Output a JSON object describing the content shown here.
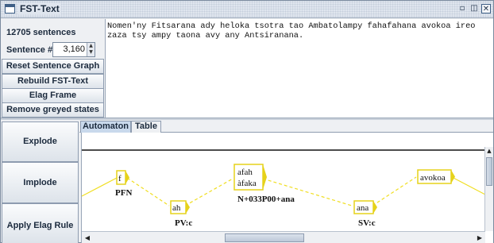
{
  "window": {
    "title": "FST-Text",
    "minimize_glyph": "▫",
    "maximize_glyph": "◫",
    "close_glyph": "✕"
  },
  "sidebar": {
    "sentence_count": "12705 sentences",
    "sentence_label": "Sentence #",
    "sentence_value": "3,160",
    "buttons": {
      "reset": "Reset Sentence Graph",
      "rebuild": "Rebuild FST-Text",
      "elag_frame": "Elag Frame",
      "remove_greyed": "Remove greyed states",
      "explode": "Explode",
      "implode": "Implode",
      "apply_elag": "Apply Elag Rule"
    }
  },
  "text": {
    "content": "Nomen'ny Fitsarana ady heloka tsotra tao Ambatolampy fahafahana avokoa ireo zaza tsy ampy taona avy any Antsiranana."
  },
  "tabs": [
    "Automaton",
    "Table"
  ],
  "active_tab": "Automaton",
  "graph": {
    "colors": {
      "box_border": "#e6d21a",
      "box_fill": "#ffffff",
      "edge": "#f0de20"
    },
    "boxes": [
      {
        "label": [
          "f"
        ],
        "output": "PFN"
      },
      {
        "label": [
          "ah"
        ],
        "output": "PV:c"
      },
      {
        "label": [
          "afah",
          "àfaka"
        ],
        "output": "N+033P00+ana"
      },
      {
        "label": [
          "ana"
        ],
        "output": "SV:c"
      },
      {
        "label": [
          "avokoa"
        ],
        "output": ""
      }
    ]
  }
}
